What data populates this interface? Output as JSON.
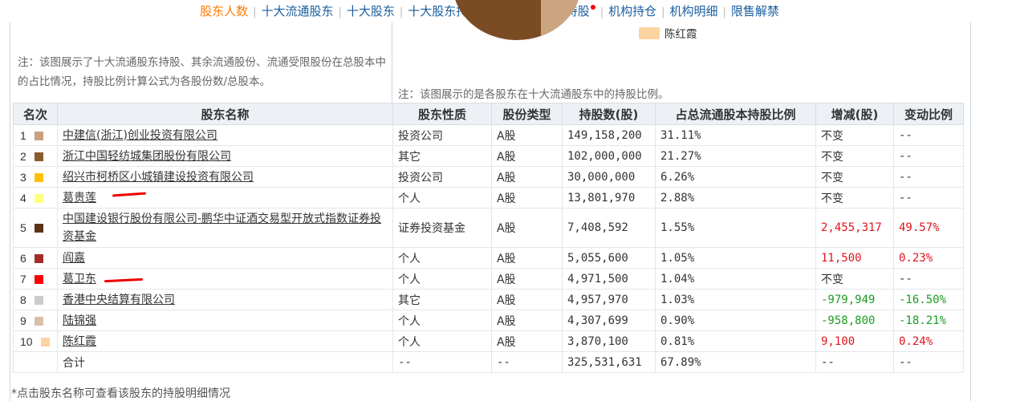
{
  "nav": {
    "items": [
      "股东人数",
      "十大流通股东",
      "十大股东",
      "十大股东持股变动",
      "沪深港通持股",
      "机构持仓",
      "机构明细",
      "限售解禁"
    ],
    "active_index": 0,
    "dot_index": 4
  },
  "notes": {
    "left": "注：该图展示了十大流通股东持股、其余流通股份、流通受限股份在总股本中的占比情况，持股比例计算公式为各股份数/总股本。",
    "right": "注：该图展示的是各股东在十大流通股东中的持股比例。"
  },
  "legend_visible": {
    "label": "陈红霞",
    "color": "#fcd3a1"
  },
  "table": {
    "headers": [
      "名次",
      "股东名称",
      "股东性质",
      "股份类型",
      "持股数(股)",
      "占总流通股本持股比例",
      "增减(股)",
      "变动比例"
    ],
    "rows": [
      {
        "rank": "1",
        "color": "#c9a27c",
        "name": "中建信(浙江)创业投资有限公司",
        "nature": "投资公司",
        "type": "A股",
        "shares": "149,158,200",
        "pct": "31.11%",
        "change": "不变",
        "ratio": "--",
        "cstyle": ""
      },
      {
        "rank": "2",
        "color": "#8b5a2b",
        "name": "浙江中国轻纺城集团股份有限公司",
        "nature": "其它",
        "type": "A股",
        "shares": "102,000,000",
        "pct": "21.27%",
        "change": "不变",
        "ratio": "--",
        "cstyle": ""
      },
      {
        "rank": "3",
        "color": "#ffc000",
        "name": "绍兴市柯桥区小城镇建设投资有限公司",
        "nature": "投资公司",
        "type": "A股",
        "shares": "30,000,000",
        "pct": "6.26%",
        "change": "不变",
        "ratio": "--",
        "cstyle": ""
      },
      {
        "rank": "4",
        "color": "#ffff80",
        "name": "葛贵莲",
        "nature": "个人",
        "type": "A股",
        "shares": "13,801,970",
        "pct": "2.88%",
        "change": "不变",
        "ratio": "--",
        "cstyle": ""
      },
      {
        "rank": "5",
        "color": "#5c3317",
        "name": "中国建设银行股份有限公司-鹏华中证酒交易型开放式指数证券投资基金",
        "nature": "证券投资基金",
        "type": "A股",
        "shares": "7,408,592",
        "pct": "1.55%",
        "change": "2,455,317",
        "ratio": "49.57%",
        "cstyle": "red"
      },
      {
        "rank": "6",
        "color": "#a52a2a",
        "name": "阎嘉",
        "nature": "个人",
        "type": "A股",
        "shares": "5,055,600",
        "pct": "1.05%",
        "change": "11,500",
        "ratio": "0.23%",
        "cstyle": "red"
      },
      {
        "rank": "7",
        "color": "#ff0000",
        "name": "葛卫东",
        "nature": "个人",
        "type": "A股",
        "shares": "4,971,500",
        "pct": "1.04%",
        "change": "不变",
        "ratio": "--",
        "cstyle": ""
      },
      {
        "rank": "8",
        "color": "#cccccc",
        "name": "香港中央结算有限公司",
        "nature": "其它",
        "type": "A股",
        "shares": "4,957,970",
        "pct": "1.03%",
        "change": "-979,949",
        "ratio": "-16.50%",
        "cstyle": "green"
      },
      {
        "rank": "9",
        "color": "#d9c0a8",
        "name": "陆锦强",
        "nature": "个人",
        "type": "A股",
        "shares": "4,307,699",
        "pct": "0.90%",
        "change": "-958,800",
        "ratio": "-18.21%",
        "cstyle": "green"
      },
      {
        "rank": "10",
        "color": "#fcd3a1",
        "name": "陈红霞",
        "nature": "个人",
        "type": "A股",
        "shares": "3,870,100",
        "pct": "0.81%",
        "change": "9,100",
        "ratio": "0.24%",
        "cstyle": "red"
      }
    ],
    "total": {
      "label": "合计",
      "nature": "--",
      "type": "--",
      "shares": "325,531,631",
      "pct": "67.89%",
      "change": "--",
      "ratio": "--"
    }
  },
  "footnote": "*点击股东名称可查看该股东的持股明细情况"
}
